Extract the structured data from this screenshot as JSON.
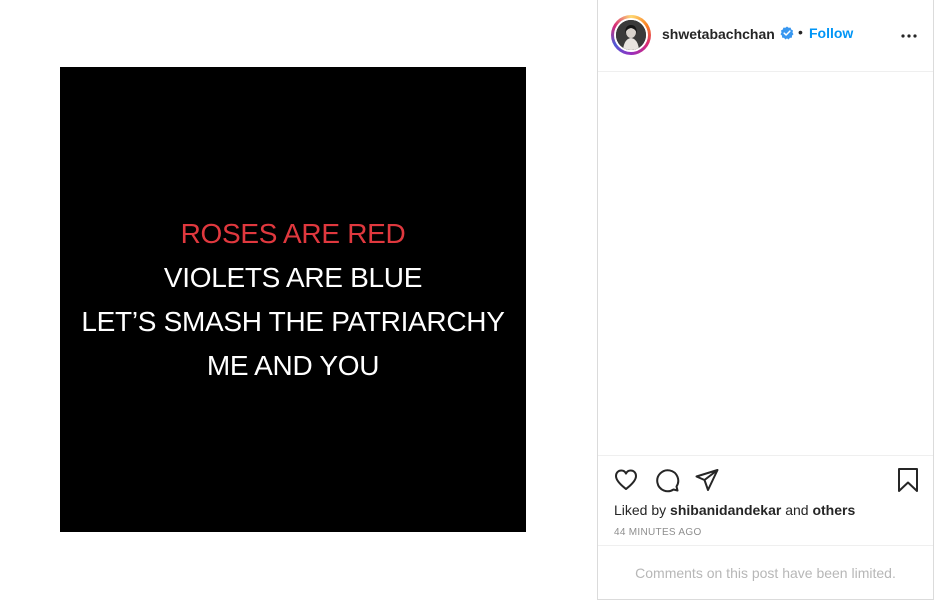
{
  "post": {
    "poem_lines": [
      "ROSES ARE RED",
      "VIOLETS ARE BLUE",
      "LET’S SMASH THE PATRIARCHY",
      "ME AND YOU"
    ],
    "accent_red": "#e0383e"
  },
  "header": {
    "username": "shwetabachchan",
    "separator": "•",
    "follow_label": "Follow",
    "verified_icon": "verified-badge-icon",
    "more_icon": "more-options-icon"
  },
  "actions": {
    "icons": [
      "heart-icon",
      "comment-icon",
      "share-icon",
      "bookmark-icon"
    ]
  },
  "likes": {
    "prefix": "Liked by",
    "user": "shibanidandekar",
    "connector": "and",
    "others": "others"
  },
  "timestamp": "44 MINUTES AGO",
  "comments_notice": "Comments on this post have been limited.",
  "colors": {
    "link_blue": "#0095f6",
    "muted": "#8e8e8e",
    "border": "#dbdbdb"
  }
}
